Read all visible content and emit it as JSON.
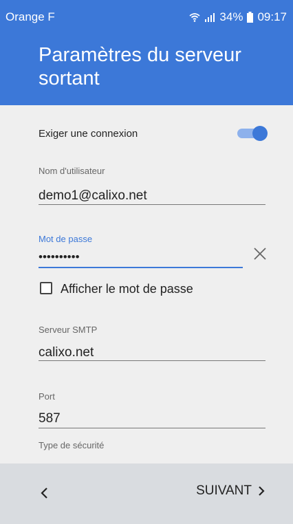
{
  "statusbar": {
    "carrier": "Orange F",
    "battery": "34%",
    "time": "09:17"
  },
  "header": {
    "title": "Paramètres du serveur sortant"
  },
  "form": {
    "require_connection_label": "Exiger une connexion",
    "require_connection_on": true,
    "username_label": "Nom d'utilisateur",
    "username_value": "demo1@calixo.net",
    "password_label": "Mot de passe",
    "password_value": "••••••••••",
    "show_password_label": "Afficher le mot de passe",
    "smtp_label": "Serveur SMTP",
    "smtp_value": "calixo.net",
    "port_label": "Port",
    "port_value": "587",
    "security_label": "Type de sécurité"
  },
  "nav": {
    "back_label": "<",
    "next_label": "SUIVANT"
  },
  "colors": {
    "accent": "#3c78d8",
    "background": "#efefef",
    "bottombar": "#d9dce0"
  }
}
